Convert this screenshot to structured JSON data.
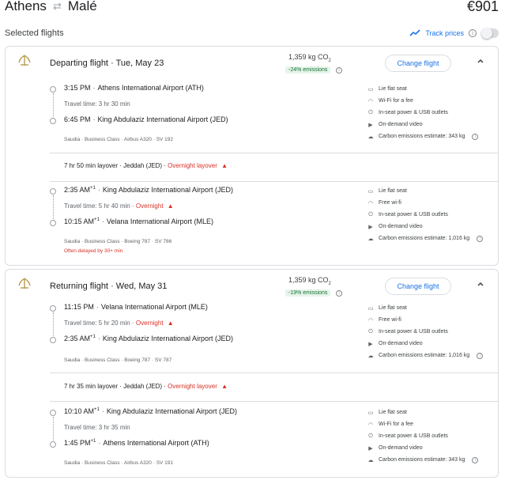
{
  "header": {
    "origin": "Athens",
    "destination": "Malé",
    "swap_icon": "⇄",
    "price": "€901"
  },
  "section_title": "Selected flights",
  "track": {
    "label": "Track prices",
    "enabled": false
  },
  "departing": {
    "title": "Departing flight",
    "date": "Tue, May 23",
    "co2": "1,359 kg CO",
    "co2_sub": "2",
    "emissions": "-24% emissions",
    "change_label": "Change flight",
    "leg1": {
      "dep_time": "3:15 PM",
      "dep_airport": "Athens International Airport (ATH)",
      "travel": "Travel time: 3 hr 30 min",
      "arr_time": "6:45 PM",
      "arr_airport": "King Abdulaziz International Airport (JED)",
      "details": "Saudia · Business Class · Airbus A320 · SV 192",
      "amenities": [
        "Lie flat seat",
        "Wi-Fi for a fee",
        "In-seat power & USB outlets",
        "On-demand video",
        "Carbon emissions estimate: 343 kg"
      ]
    },
    "layover": "7 hr 50 min layover · Jeddah (JED) ·",
    "layover_warn": "Overnight layover",
    "leg2": {
      "dep_time": "2:35 AM",
      "dep_sup": "+1",
      "dep_airport": "King Abdulaziz International Airport (JED)",
      "travel": "Travel time: 5 hr 40 min ·",
      "travel_warn": "Overnight",
      "arr_time": "10:15 AM",
      "arr_sup": "+1",
      "arr_airport": "Velana International Airport (MLE)",
      "details": "Saudia · Business Class · Boeing 787 · SV 786",
      "delay": "Often delayed by 30+ min",
      "amenities": [
        "Lie flat seat",
        "Free wi-fi",
        "In-seat power & USB outlets",
        "On-demand video",
        "Carbon emissions estimate: 1,016 kg"
      ]
    }
  },
  "returning": {
    "title": "Returning flight",
    "date": "Wed, May 31",
    "co2": "1,359 kg CO",
    "co2_sub": "2",
    "emissions": "-19% emissions",
    "change_label": "Change flight",
    "leg1": {
      "dep_time": "11:15 PM",
      "dep_airport": "Velana International Airport (MLE)",
      "travel": "Travel time: 5 hr 20 min ·",
      "travel_warn": "Overnight",
      "arr_time": "2:35 AM",
      "arr_sup": "+1",
      "arr_airport": "King Abdulaziz International Airport (JED)",
      "details": "Saudia · Business Class · Boeing 787 · SV 787",
      "amenities": [
        "Lie flat seat",
        "Free wi-fi",
        "In-seat power & USB outlets",
        "On-demand video",
        "Carbon emissions estimate: 1,016 kg"
      ]
    },
    "layover": "7 hr 35 min layover · Jeddah (JED) ·",
    "layover_warn": "Overnight layover",
    "leg2": {
      "dep_time": "10:10 AM",
      "dep_sup": "+1",
      "dep_airport": "King Abdulaziz International Airport (JED)",
      "travel": "Travel time: 3 hr 35 min",
      "arr_time": "1:45 PM",
      "arr_sup": "+1",
      "arr_airport": "Athens International Airport (ATH)",
      "details": "Saudia · Business Class · Airbus A320 · SV 191",
      "amenities": [
        "Lie flat seat",
        "Wi-Fi for a fee",
        "In-seat power & USB outlets",
        "On-demand video",
        "Carbon emissions estimate: 343 kg"
      ]
    }
  },
  "amenity_icons": [
    "seat-icon",
    "wifi-icon",
    "power-icon",
    "video-icon",
    "co2-icon"
  ],
  "colors": {
    "accent": "#1a73e8",
    "warning": "#d93025",
    "green_badge_bg": "#e6f4ea",
    "green_badge_text": "#137333"
  }
}
